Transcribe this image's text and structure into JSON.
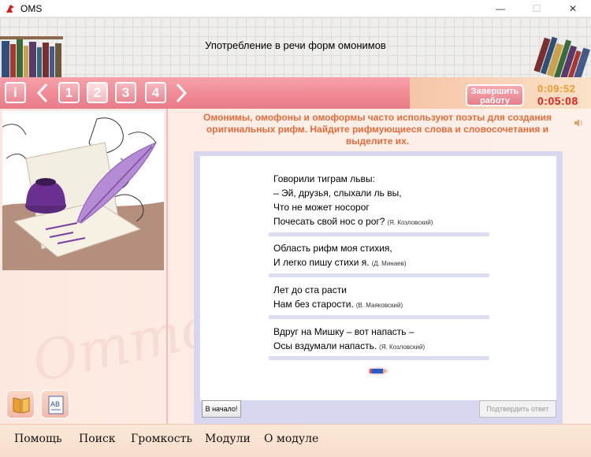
{
  "window": {
    "title": "OMS"
  },
  "header": {
    "title": "Употребление в речи форм омонимов"
  },
  "nav": {
    "pages": [
      "i",
      "1",
      "2",
      "3",
      "4"
    ],
    "active_page": "2",
    "finish_label_line1": "Завершить",
    "finish_label_line2": "работу",
    "timer_elapsed": "0:09:52",
    "timer_remaining": "0:05:08"
  },
  "task": {
    "instruction": "Омонимы, омофоны и омоформы часто используют поэты для создания оригинальных рифм. Найдите рифмующиеся слова и словосочетания и выделите их.",
    "stanzas": [
      {
        "lines": [
          "Говорили тиграм львы:",
          "– Эй, друзья, слыхали ль вы,",
          "Что не может носорог",
          "Почесать свой нос о рог?"
        ],
        "author": "(Я. Козловский)"
      },
      {
        "lines": [
          "Область рифм моя стихия,",
          "И легко пишу стихи я."
        ],
        "author": "(Д. Минаев)"
      },
      {
        "lines": [
          "Лет до ста расти",
          "Нам без старости."
        ],
        "author": "(В. Маяковский)"
      },
      {
        "lines": [
          "Вдруг на Мишку – вот напасть –",
          "Осы вздумали напасть."
        ],
        "author": "(Я. Козловский)"
      }
    ],
    "start_button": "В начало!",
    "confirm_button": "Подтвердить ответ"
  },
  "menu": [
    "Помощь",
    "Поиск",
    "Громкость",
    "Модули",
    "О модуле"
  ],
  "colors": {
    "nav_pink": "#ef8893",
    "instruction": "#e56b3b",
    "timer_elapsed": "#f09a2a",
    "timer_remaining": "#e02020"
  }
}
